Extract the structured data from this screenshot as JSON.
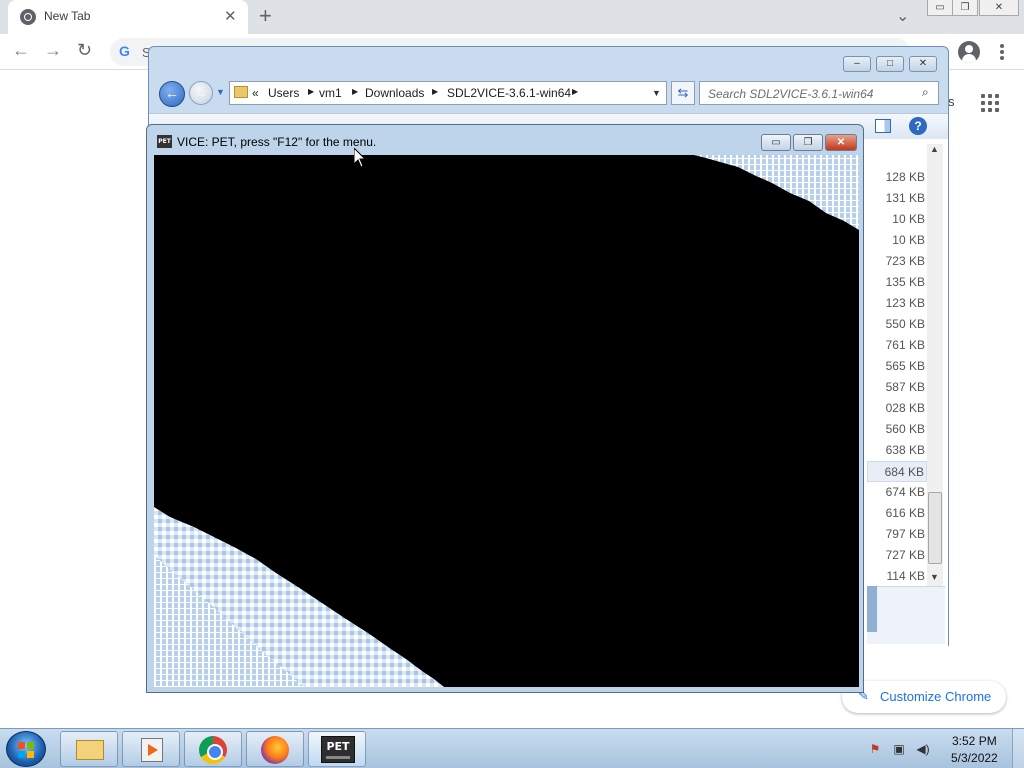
{
  "chrome": {
    "tab_title": "New Tab",
    "tab_close_glyph": "✕",
    "new_tab_glyph": "+",
    "tab_search_glyph": "⌄",
    "nav_back_glyph": "←",
    "nav_forward_glyph": "→",
    "nav_reload_glyph": "↻",
    "omnibox_g": "G",
    "omnibox_text": "S",
    "window_minimize_glyph": "▭",
    "window_restore_glyph": "❐",
    "window_close_glyph": "✕",
    "ntp_partial_text": "s",
    "customize_label": "Customize Chrome",
    "customize_icon": "✎",
    "accent_color": "#1a73e8"
  },
  "explorer": {
    "breadcrumb": {
      "overflow": "«",
      "items": [
        "Users",
        "vm1",
        "Downloads",
        "SDL2VICE-3.6.1-win64"
      ]
    },
    "search_placeholder": "Search SDL2VICE-3.6.1-win64",
    "back_glyph": "←",
    "forward_glyph": "→",
    "refresh_glyph": "⇆",
    "help_glyph": "?",
    "file_sizes": [
      "128 KB",
      "131 KB",
      "10 KB",
      "10 KB",
      "723 KB",
      "135 KB",
      "123 KB",
      "550 KB",
      "761 KB",
      "565 KB",
      "587 KB",
      "028 KB",
      "560 KB",
      "638 KB",
      "684 KB",
      "674 KB",
      "616 KB",
      "797 KB",
      "727 KB",
      "114 KB"
    ],
    "selected_row": 14
  },
  "vice": {
    "icon_label": "PET",
    "title": "VICE: PET, press \"F12\" for the menu.",
    "minimize_glyph": "▭",
    "restore_glyph": "❐",
    "close_glyph": "✕"
  },
  "taskbar": {
    "pet_label": "PET",
    "time": "3:52 PM",
    "date": "5/3/2022",
    "tray_icons": [
      "action-center-flag-icon",
      "network-icon",
      "volume-icon"
    ]
  }
}
